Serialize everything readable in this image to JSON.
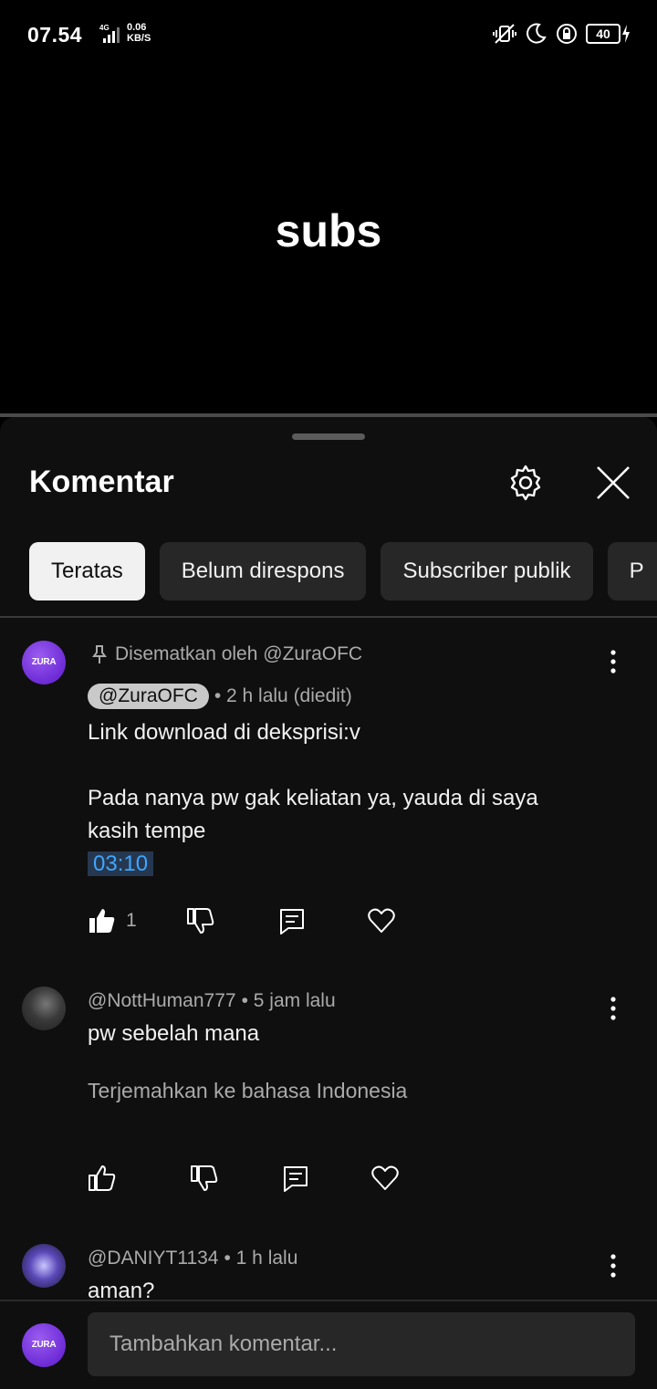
{
  "status_bar": {
    "time": "07.54",
    "network": "4G",
    "speed_value": "0.06",
    "speed_unit": "KB/S",
    "battery": "40"
  },
  "video": {
    "overlay_text": "subs"
  },
  "comments_panel": {
    "title": "Komentar",
    "chips": [
      {
        "label": "Teratas",
        "active": true
      },
      {
        "label": "Belum direspons",
        "active": false
      },
      {
        "label": "Subscriber publik",
        "active": false
      },
      {
        "label": "P",
        "active": false
      }
    ],
    "comments": [
      {
        "avatar_text": "ZURA OFC",
        "pinned_label": "Disematkan oleh @ZuraOFC",
        "author": "@ZuraOFC",
        "time": "• 2 h lalu (diedit)",
        "text_line1": "Link download di deksprisi:v",
        "text_line2": "Pada nanya pw gak keliatan ya, yauda di saya",
        "text_line3": "kasih tempe",
        "timestamp": "03:10",
        "likes": "1"
      },
      {
        "author": "@NottHuman777",
        "time": "• 5 jam lalu",
        "text": "pw sebelah mana",
        "translate": "Terjemahkan ke bahasa Indonesia"
      },
      {
        "author": "@DANIYT1134",
        "time": "• 1 h lalu",
        "text": "aman?"
      }
    ],
    "add_comment": {
      "avatar_text": "ZURA OFC",
      "placeholder": "Tambahkan komentar..."
    }
  },
  "icons": [
    "settings-gear-icon",
    "close-icon",
    "pin-icon",
    "like-icon",
    "dislike-icon",
    "reply-icon",
    "heart-icon",
    "more-vert-icon"
  ]
}
